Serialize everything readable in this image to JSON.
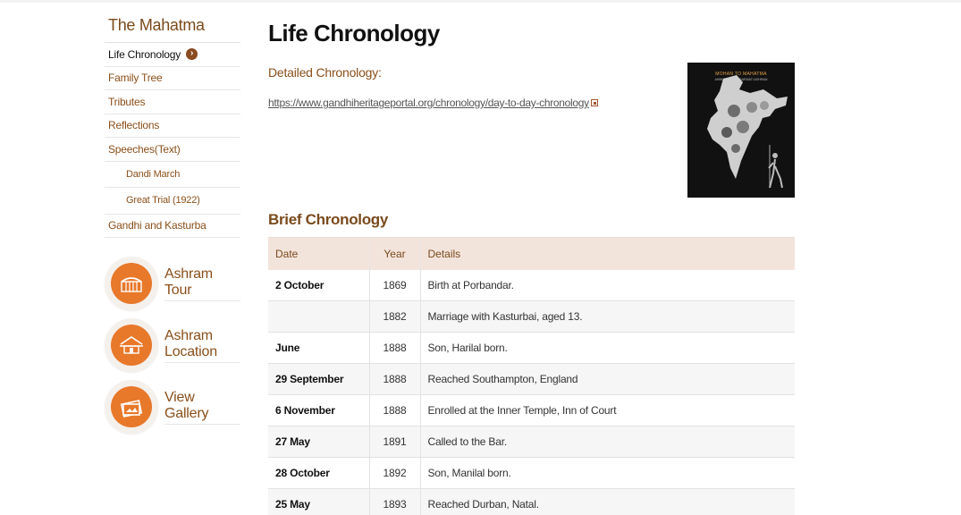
{
  "sidebar": {
    "title": "The Mahatma",
    "items": [
      {
        "label": "Life Chronology",
        "active": true
      },
      {
        "label": "Family Tree"
      },
      {
        "label": "Tributes"
      },
      {
        "label": "Reflections"
      },
      {
        "label": "Speeches(Text)"
      },
      {
        "label": "Dandi March",
        "sub": true
      },
      {
        "label": "Great Trial (1922)",
        "sub": true
      },
      {
        "label": "Gandhi and Kasturba"
      }
    ],
    "active_icon": "chevron-right-icon",
    "promos": [
      {
        "line1": "Ashram",
        "line2": "Tour",
        "icon": "gate-icon"
      },
      {
        "line1": "Ashram",
        "line2": "Location",
        "icon": "hut-icon"
      },
      {
        "line1": "View",
        "line2": "Gallery",
        "icon": "gallery-icon"
      }
    ]
  },
  "main": {
    "title": "Life Chronology",
    "detailed_heading": "Detailed Chronology:",
    "link_text": "https://www.gandhiheritageportal.org/chronology/day-to-day-chronology",
    "book": {
      "title": "MOHAN TO MAHATMA",
      "subtitle": "AHMEDABAD SABARMATI ASHRAM"
    },
    "brief_heading": "Brief Chronology",
    "table": {
      "headers": {
        "date": "Date",
        "year": "Year",
        "details": "Details"
      },
      "rows": [
        {
          "date": "2 October",
          "year": "1869",
          "details": "Birth at Porbandar."
        },
        {
          "date": "",
          "year": "1882",
          "details": "Marriage with Kasturbai, aged 13."
        },
        {
          "date": "June",
          "year": "1888",
          "details": "Son, Harilal born."
        },
        {
          "date": "29 September",
          "year": "1888",
          "details": "Reached Southampton, England"
        },
        {
          "date": "6 November",
          "year": "1888",
          "details": "Enrolled at the Inner Temple, Inn of Court"
        },
        {
          "date": "27 May",
          "year": "1891",
          "details": "Called to the Bar."
        },
        {
          "date": "28 October",
          "year": "1892",
          "details": "Son, Manilal born."
        },
        {
          "date": "25 May",
          "year": "1893",
          "details": "Reached Durban, Natal."
        }
      ]
    }
  },
  "colors": {
    "accent": "#8a4f1a",
    "orange": "#e8782a",
    "header_bg": "#f3e4db"
  }
}
